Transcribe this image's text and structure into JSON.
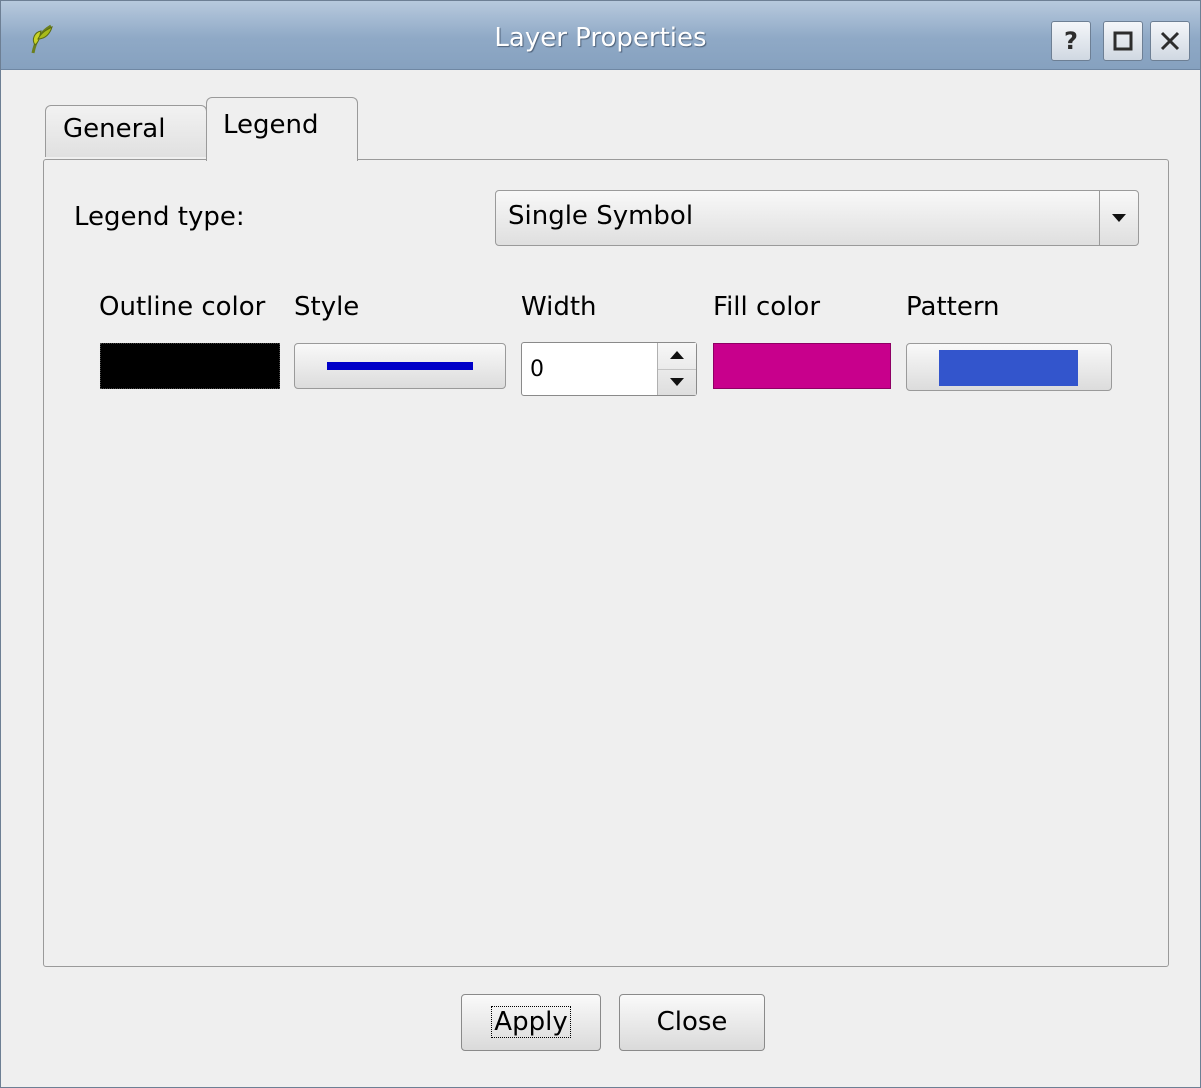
{
  "window": {
    "title": "Layer Properties",
    "help_label": "?",
    "maximize_label": "□",
    "close_label": "✕"
  },
  "tabs": [
    {
      "label": "General",
      "active": false
    },
    {
      "label": "Legend",
      "active": true
    }
  ],
  "legend": {
    "type_label": "Legend type:",
    "type_value": "Single Symbol"
  },
  "columns": {
    "outline_color": "Outline color",
    "style": "Style",
    "width": "Width",
    "fill_color": "Fill color",
    "pattern": "Pattern"
  },
  "values": {
    "outline_color": "#000000",
    "style_line_color": "#0000c8",
    "width": "0",
    "fill_color": "#c8008c",
    "pattern_color": "#3355cc"
  },
  "footer": {
    "apply_label": "Apply",
    "close_label": "Close"
  },
  "icons": {
    "app": "qgis-icon",
    "help": "help-icon",
    "maximize": "maximize-icon",
    "close": "close-icon"
  }
}
